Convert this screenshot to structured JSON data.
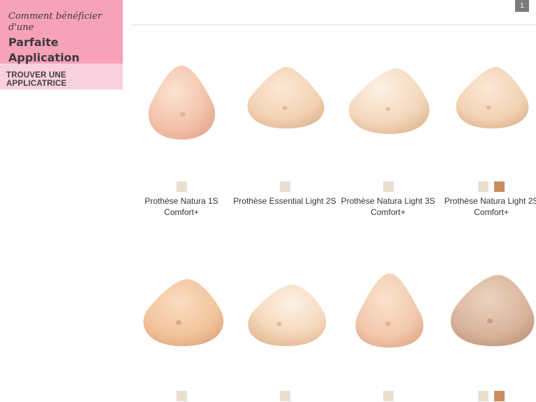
{
  "sidebar": {
    "promo": {
      "line1": "Comment bénéficier d'une",
      "line2": "Parfaite Application"
    },
    "applicatrice_link": "TROUVER UNE APPLICATRICE"
  },
  "pagination": {
    "current_page": "1"
  },
  "products": [
    {
      "name": "Prothèse Natura 1S Comfort+",
      "swatches": [
        "#eadfcf"
      ]
    },
    {
      "name": "Prothèse Essential Light 2S",
      "swatches": [
        "#eadfcf"
      ]
    },
    {
      "name": "Prothèse Natura Light 3S Comfort+",
      "swatches": [
        "#eadfcf"
      ]
    },
    {
      "name": "Prothèse Natura Light 2S Comfort+",
      "swatches": [
        "#eadfcf",
        "#c98e60"
      ]
    },
    {
      "name": "",
      "swatches": [
        "#eadfcf"
      ]
    },
    {
      "name": "",
      "swatches": [
        "#eadfcf"
      ]
    },
    {
      "name": "",
      "swatches": [
        "#eadfcf"
      ]
    },
    {
      "name": "",
      "swatches": [
        "#eadfcf",
        "#c98e60"
      ]
    }
  ],
  "colors": {
    "promo_background": "#f7a1bb",
    "link_background": "#f9d1dc",
    "badge_background": "#7b7b7b"
  }
}
